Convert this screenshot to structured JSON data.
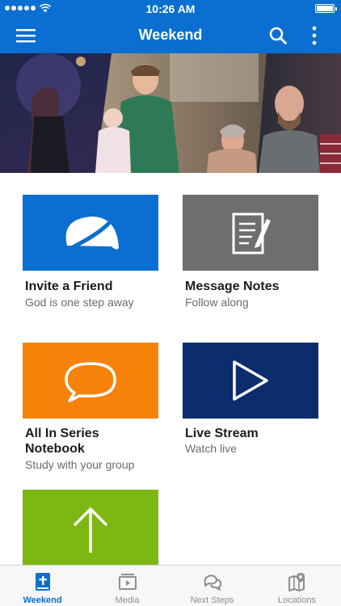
{
  "status_bar": {
    "time": "10:26 AM"
  },
  "app_bar": {
    "title": "Weekend"
  },
  "tiles": [
    {
      "title": "Invite a Friend",
      "subtitle": "God is one step away",
      "color": "#0a6fd0",
      "icon": "speedometer-icon"
    },
    {
      "title": "Message Notes",
      "subtitle": "Follow along",
      "color": "#6e6e6e",
      "icon": "notepad-pen-icon"
    },
    {
      "title_line1": "All In Series",
      "title_line2": "Notebook",
      "subtitle": "Study with your group",
      "color": "#f7820a",
      "icon": "chat-bubble-icon"
    },
    {
      "title": "Live Stream",
      "subtitle": "Watch live",
      "color": "#0b2d6e",
      "icon": "play-icon"
    },
    {
      "color": "#7cb812",
      "icon": "arrow-up-icon"
    }
  ],
  "tabs": [
    {
      "label": "Weekend",
      "icon": "bible-icon",
      "active": true
    },
    {
      "label": "Media",
      "icon": "media-play-icon",
      "active": false
    },
    {
      "label": "Next Steps",
      "icon": "chat-bubbles-icon",
      "active": false
    },
    {
      "label": "Locations",
      "icon": "map-pin-icon",
      "active": false
    }
  ],
  "colors": {
    "brand_blue": "#0a6fd0",
    "tab_inactive": "#8e8e8e"
  }
}
